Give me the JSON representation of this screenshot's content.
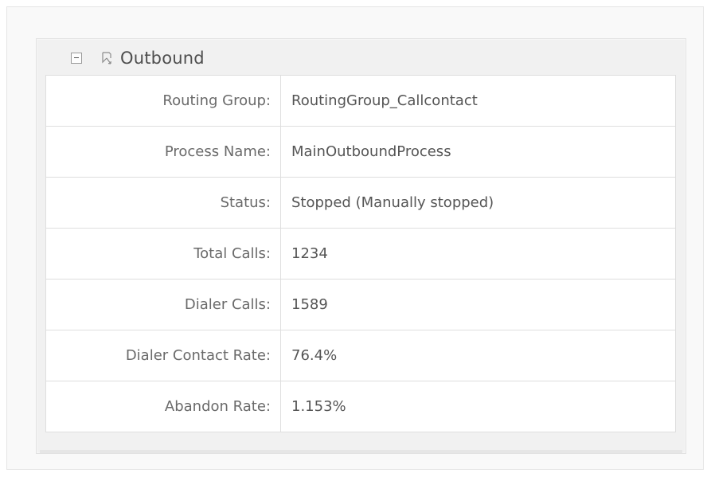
{
  "panel": {
    "title": "Outbound",
    "collapse_icon": "collapse-minus-icon",
    "section_icon": "route-arrow-icon"
  },
  "properties": [
    {
      "label": "Routing Group:",
      "value": "RoutingGroup_Callcontact"
    },
    {
      "label": "Process Name:",
      "value": "MainOutboundProcess"
    },
    {
      "label": "Status:",
      "value": "Stopped (Manually stopped)"
    },
    {
      "label": "Total Calls:",
      "value": "1234"
    },
    {
      "label": "Dialer Calls:",
      "value": "1589"
    },
    {
      "label": "Dialer Contact Rate:",
      "value": "76.4%"
    },
    {
      "label": "Abandon Rate:",
      "value": "1.153%"
    }
  ],
  "colors": {
    "background": "#ffffff",
    "panel_background": "#f1f1f1",
    "border": "#dedede",
    "label_text": "#6a6a6a",
    "value_text": "#555555",
    "title_text": "#4e4e4e"
  }
}
